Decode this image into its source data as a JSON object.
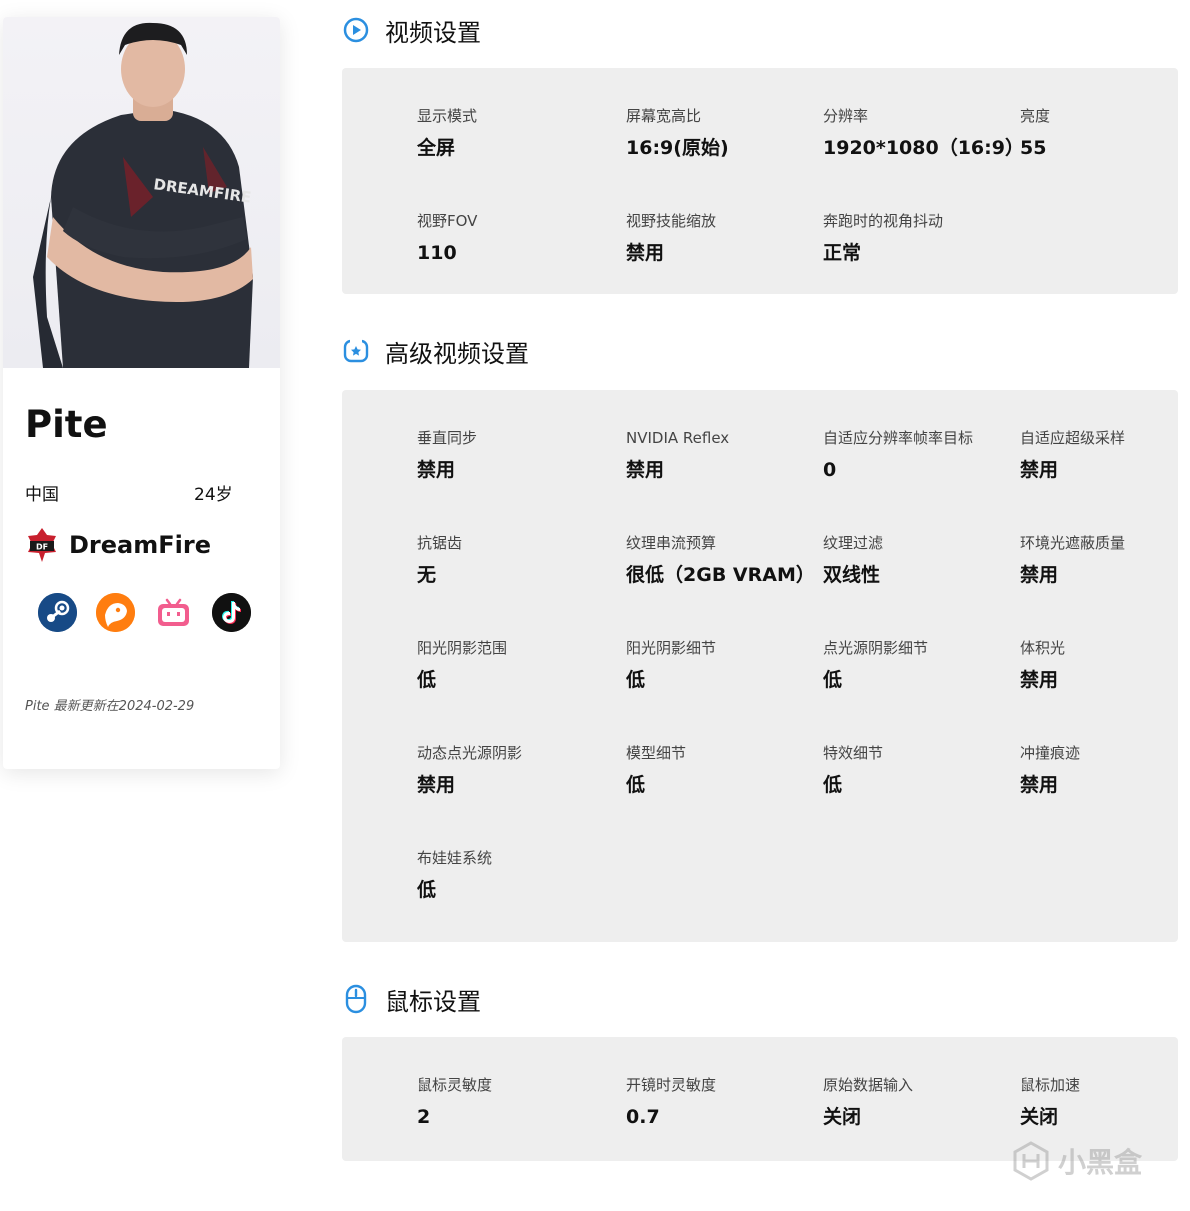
{
  "profile": {
    "name": "Pite",
    "country": "中国",
    "age": "24岁",
    "team": "DreamFire",
    "updated": "Pite 最新更新在2024-02-29",
    "socials": [
      "steam-icon",
      "douyu-icon",
      "bilibili-icon",
      "tiktok-icon"
    ]
  },
  "video": {
    "title": "视频设置",
    "items": [
      {
        "label": "显示模式",
        "value": "全屏"
      },
      {
        "label": "屏幕宽高比",
        "value": "16:9(原始)"
      },
      {
        "label": "分辨率",
        "value": "1920*1080（16:9）"
      },
      {
        "label": "亮度",
        "value": "55"
      },
      {
        "label": "视野FOV",
        "value": "110"
      },
      {
        "label": "视野技能缩放",
        "value": "禁用"
      },
      {
        "label": "奔跑时的视角抖动",
        "value": "正常"
      }
    ]
  },
  "advanced": {
    "title": "高级视频设置",
    "items": [
      {
        "label": "垂直同步",
        "value": "禁用"
      },
      {
        "label": "NVIDIA Reflex",
        "value": "禁用"
      },
      {
        "label": "自适应分辨率帧率目标",
        "value": "0"
      },
      {
        "label": "自适应超级采样",
        "value": "禁用"
      },
      {
        "label": "抗锯齿",
        "value": "无"
      },
      {
        "label": "纹理串流预算",
        "value": "很低（2GB VRAM）"
      },
      {
        "label": "纹理过滤",
        "value": "双线性"
      },
      {
        "label": "环境光遮蔽质量",
        "value": "禁用"
      },
      {
        "label": "阳光阴影范围",
        "value": "低"
      },
      {
        "label": "阳光阴影细节",
        "value": "低"
      },
      {
        "label": "点光源阴影细节",
        "value": "低"
      },
      {
        "label": "体积光",
        "value": "禁用"
      },
      {
        "label": "动态点光源阴影",
        "value": "禁用"
      },
      {
        "label": "模型细节",
        "value": "低"
      },
      {
        "label": "特效细节",
        "value": "低"
      },
      {
        "label": "冲撞痕迹",
        "value": "禁用"
      },
      {
        "label": "布娃娃系统",
        "value": "低"
      }
    ]
  },
  "mouse": {
    "title": "鼠标设置",
    "items": [
      {
        "label": "鼠标灵敏度",
        "value": "2"
      },
      {
        "label": "开镜时灵敏度",
        "value": "0.7"
      },
      {
        "label": "原始数据输入",
        "value": "关闭"
      },
      {
        "label": "鼠标加速",
        "value": "关闭"
      }
    ]
  },
  "watermark": {
    "text": "小黑盒"
  },
  "colors": {
    "accent": "#2b8fe0",
    "panel": "#eeeeee"
  }
}
